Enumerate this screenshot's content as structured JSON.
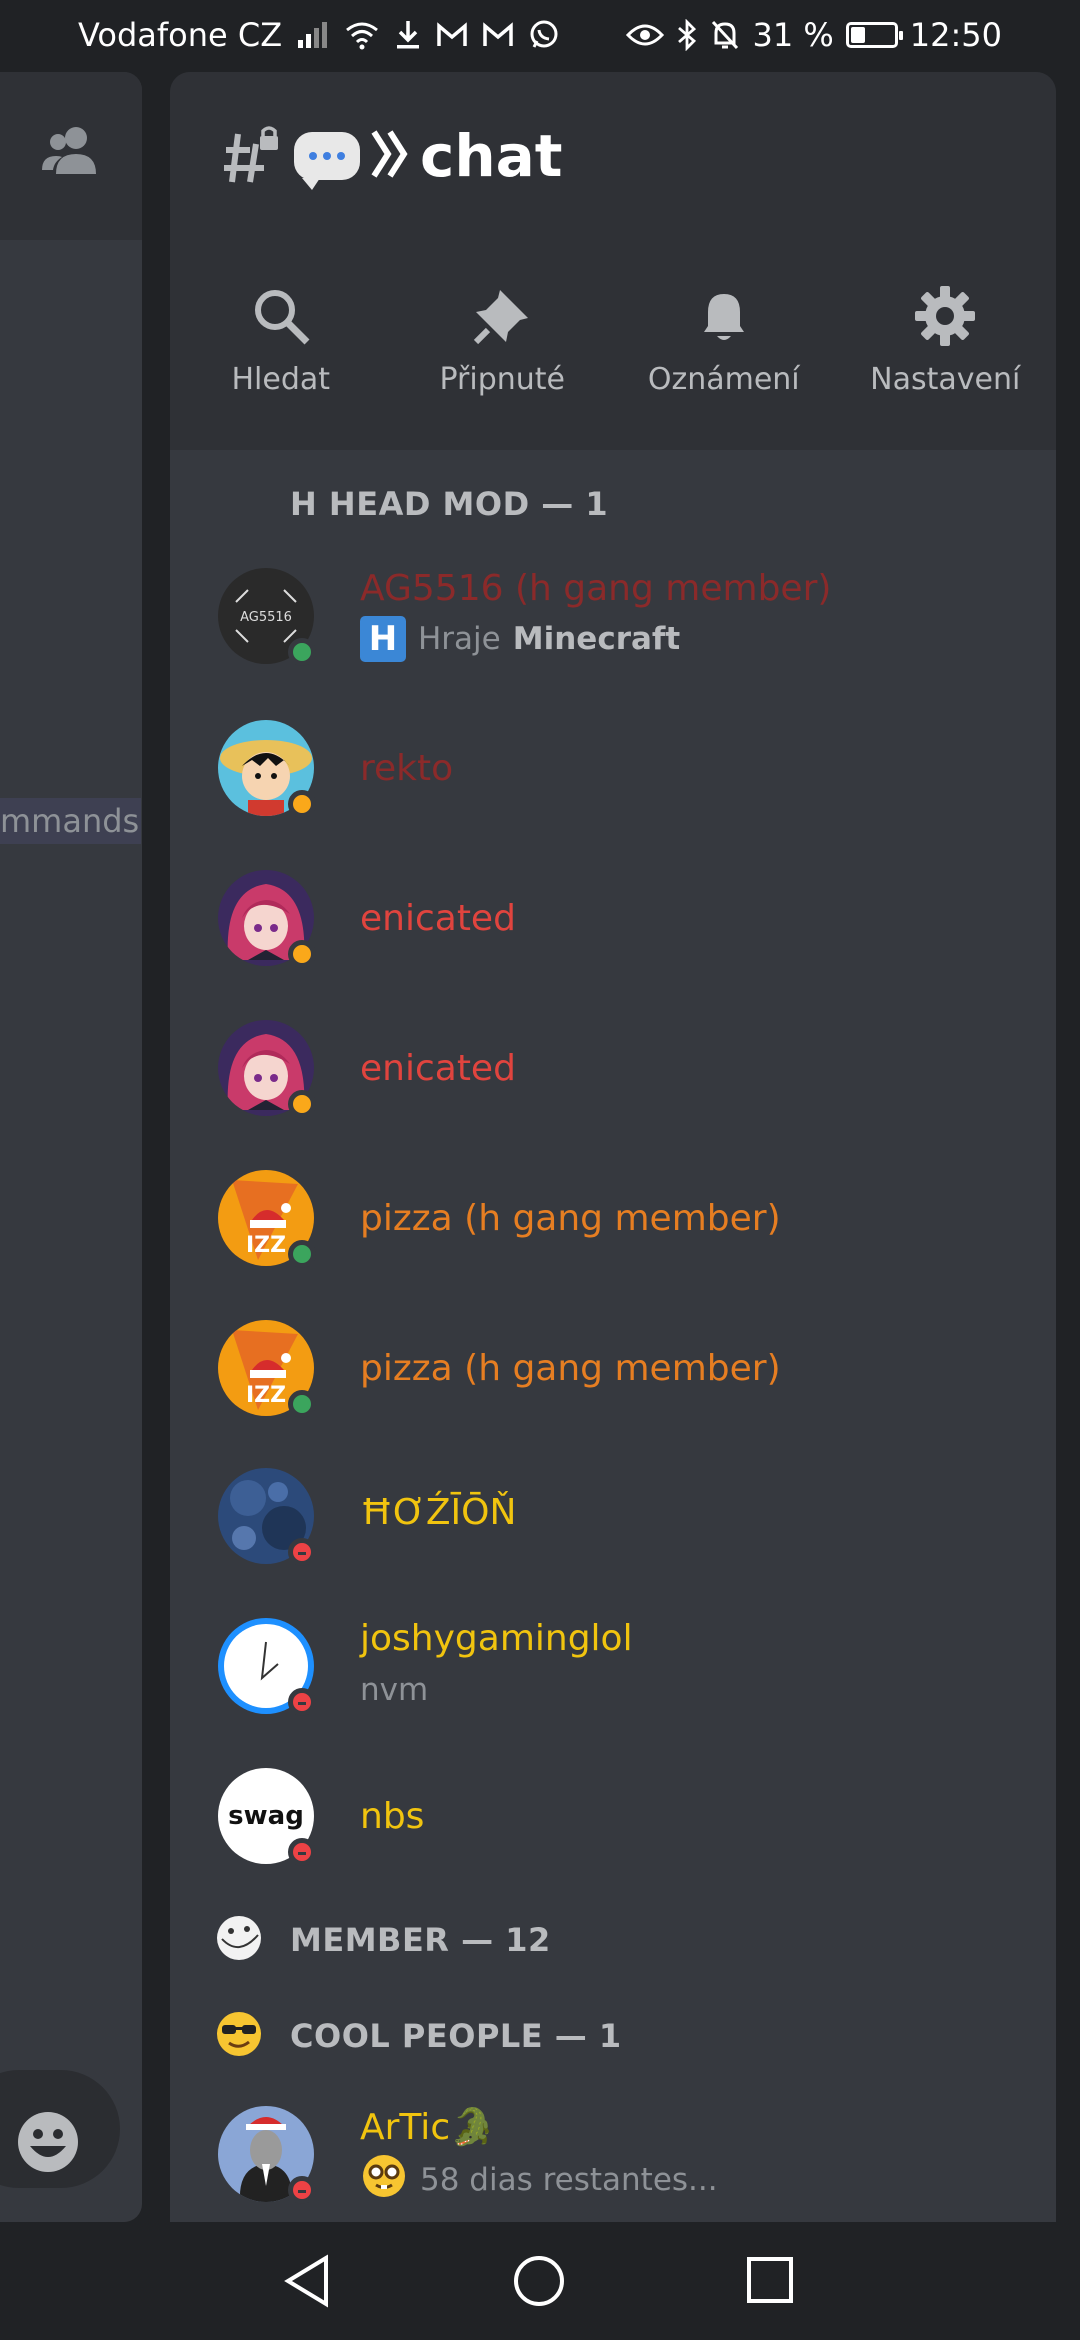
{
  "status_bar": {
    "carrier": "Vodafone CZ",
    "battery_percent": "31 %",
    "battery_level": 0.31,
    "time": "12:50",
    "icons": [
      "signal-icon",
      "wifi-icon",
      "download-icon",
      "gmail-icon",
      "gmail-icon",
      "whatsapp-icon",
      "eye-icon",
      "bluetooth-icon",
      "bell-off-icon",
      "battery-icon"
    ]
  },
  "left_panel": {
    "commands_fragment": "mmands"
  },
  "channel": {
    "title": "chat",
    "icons": [
      "locked-hash-icon",
      "speech-bubble-emoji",
      "double-chevron-icon"
    ]
  },
  "actions": [
    {
      "label": "Hledat",
      "icon": "search-icon"
    },
    {
      "label": "Připnuté",
      "icon": "pin-icon"
    },
    {
      "label": "Oznámení",
      "icon": "bell-icon"
    },
    {
      "label": "Nastavení",
      "icon": "gear-icon"
    }
  ],
  "sections": {
    "head_mod": "H HEAD MOD — 1",
    "member": "MEMBER — 12",
    "cool_people": "COOL PEOPLE — 1"
  },
  "members": [
    {
      "name": "AG5516 (h gang member)",
      "color": "#8b2a2a",
      "status": "online",
      "activity_prefix": "Hraje",
      "activity_game": "Minecraft",
      "avatar_text": "AG5516"
    },
    {
      "name": "rekto",
      "color": "#8b2a2a",
      "status": "idle"
    },
    {
      "name": "enicated",
      "color": "#e0443e",
      "status": "idle"
    },
    {
      "name": "enicated",
      "color": "#e0443e",
      "status": "idle"
    },
    {
      "name": "pizza (h gang member)",
      "color": "#e67e22",
      "status": "online",
      "avatar_text": "IZZ"
    },
    {
      "name": "pizza (h gang member)",
      "color": "#e67e22",
      "status": "online",
      "avatar_text": "IZZ"
    },
    {
      "name": "ĦƠŹĪŌŇ",
      "color": "#f1c40f",
      "status": "dnd"
    },
    {
      "name": "joshygaminglol",
      "color": "#f1c40f",
      "status": "dnd",
      "subtitle": "nvm"
    },
    {
      "name": "nbs",
      "color": "#f1c40f",
      "status": "dnd",
      "avatar_text": "swag"
    },
    {
      "name": "ArTic🐊",
      "color": "#f1c40f",
      "status": "dnd",
      "subtitle": "58 dias restantes..."
    }
  ],
  "colors": {
    "background": "#36393f",
    "drawer_header": "#2f3136",
    "online": "#3ba55d",
    "idle": "#faa81a",
    "dnd": "#ed4245"
  }
}
